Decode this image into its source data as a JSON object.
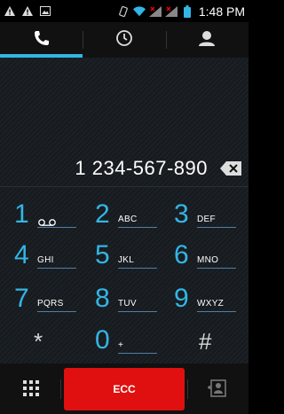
{
  "status_bar": {
    "time": "1:48",
    "time_period": "PM",
    "left_icons": [
      "warning-icon",
      "warning-icon",
      "image-icon"
    ],
    "right_icons": [
      "vibrate-icon",
      "wifi-icon",
      "signal-icon",
      "signal-icon",
      "battery-icon"
    ]
  },
  "tabs": [
    {
      "icon": "phone-icon",
      "active": true
    },
    {
      "icon": "clock-icon",
      "active": false
    },
    {
      "icon": "contact-icon",
      "active": false
    }
  ],
  "dialed_number": "1 234-567-890",
  "keypad": [
    {
      "digit": "1",
      "letters": ""
    },
    {
      "digit": "2",
      "letters": "ABC"
    },
    {
      "digit": "3",
      "letters": "DEF"
    },
    {
      "digit": "4",
      "letters": "GHI"
    },
    {
      "digit": "5",
      "letters": "JKL"
    },
    {
      "digit": "6",
      "letters": "MNO"
    },
    {
      "digit": "7",
      "letters": "PQRS"
    },
    {
      "digit": "8",
      "letters": "TUV"
    },
    {
      "digit": "9",
      "letters": "WXYZ"
    },
    {
      "digit": "*",
      "letters": ""
    },
    {
      "digit": "0",
      "letters": "+"
    },
    {
      "digit": "#",
      "letters": ""
    }
  ],
  "bottom_bar": {
    "ecc_label": "ECC",
    "accent": "#33b5e5",
    "ecc_color": "#e01010"
  }
}
